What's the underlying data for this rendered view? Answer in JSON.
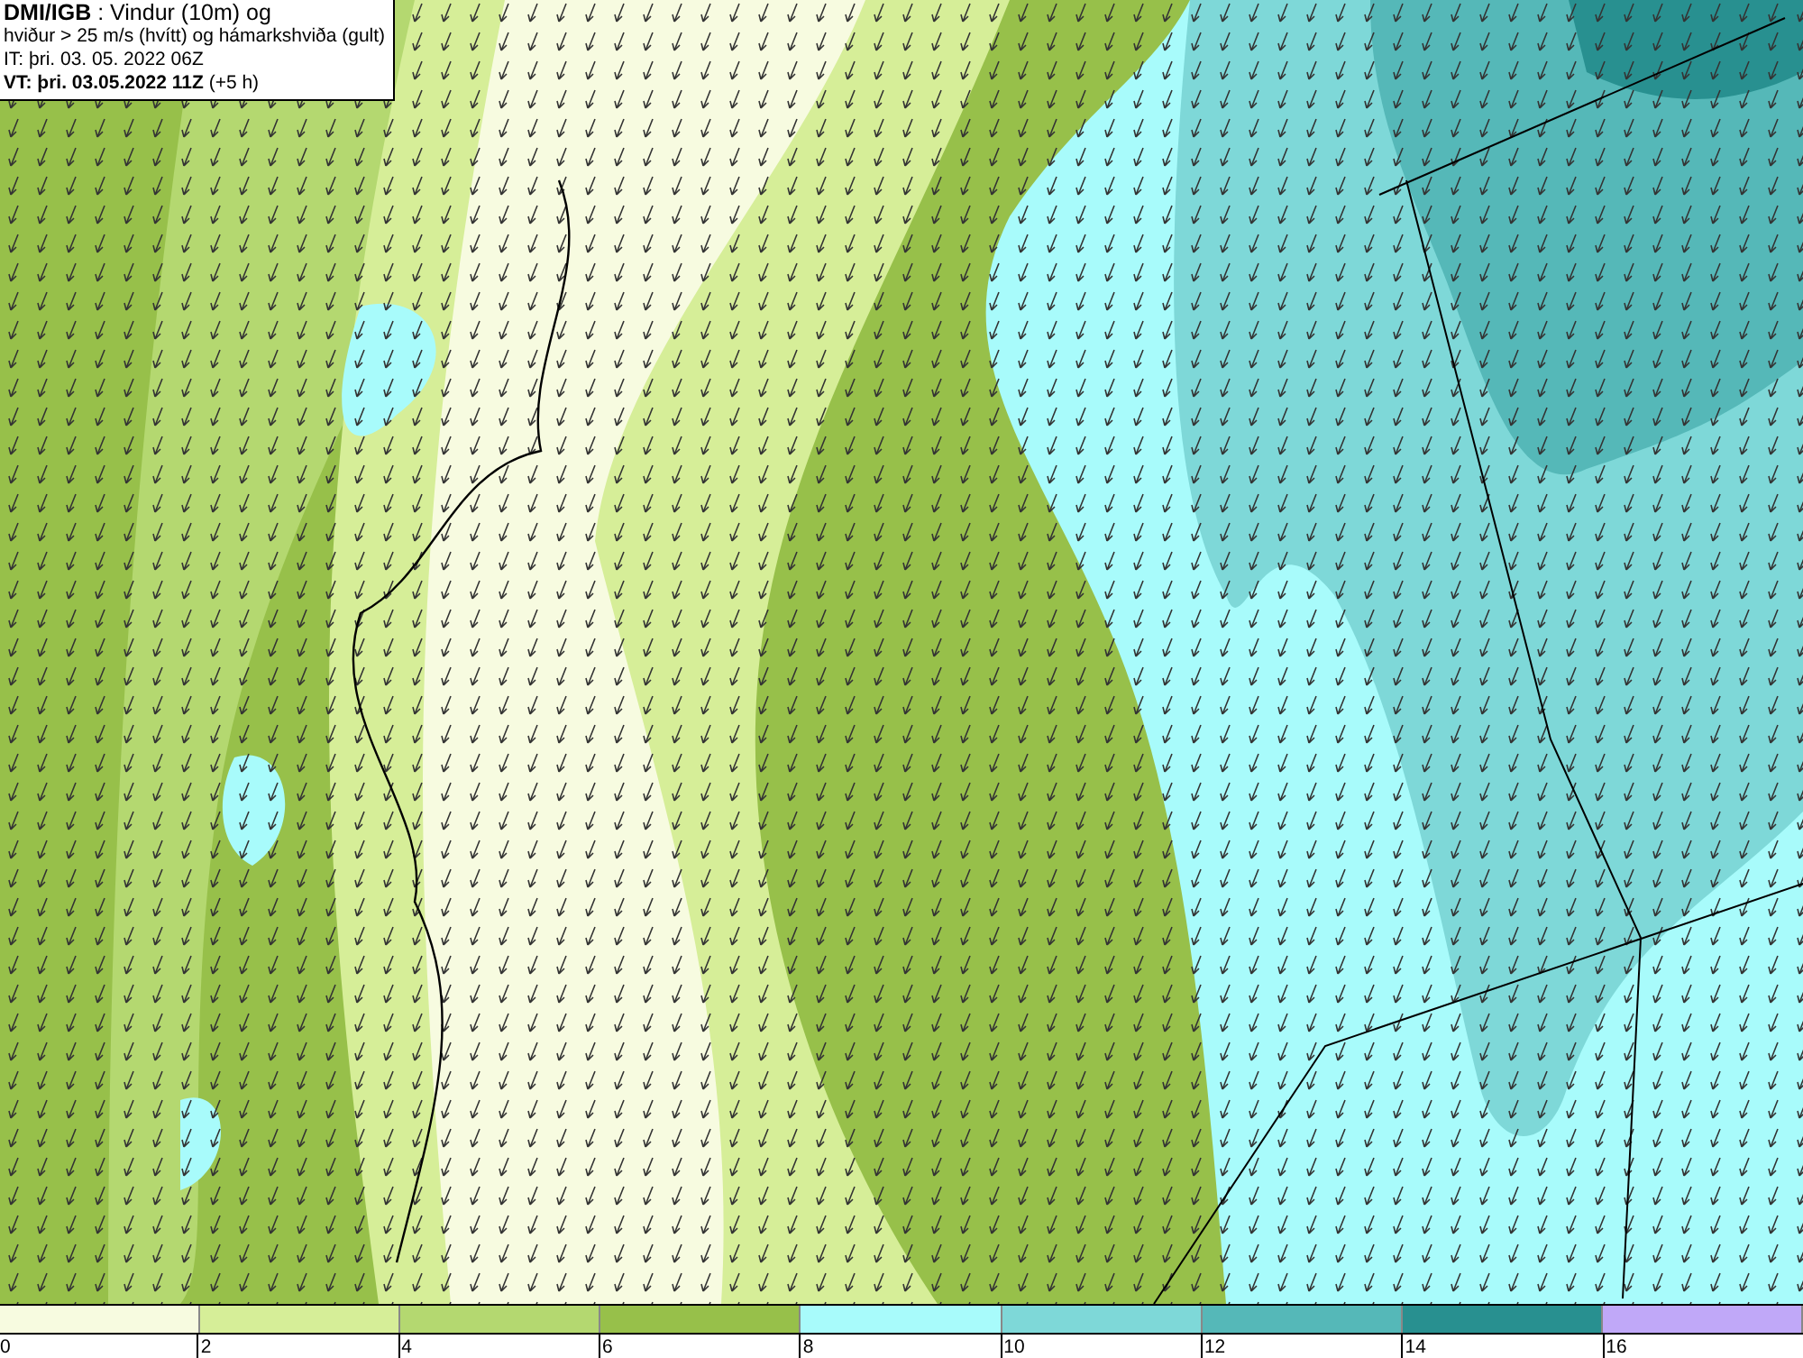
{
  "title_box": {
    "lines": [
      "**DMI/IGB** : Vindur (10m) og",
      "hviður > 25 m/s (hvítt) og hámarkshviða (gult)",
      "IT: þri. 03. 05. 2022 06Z",
      "**VT: þri. 03.05.2022 11Z** (+5 h)"
    ]
  },
  "legend": {
    "segments": [
      {
        "color": "#f7fbe0"
      },
      {
        "color": "#d6ee98"
      },
      {
        "color": "#b4d870"
      },
      {
        "color": "#97c04a"
      },
      {
        "color": "#a8fbfb"
      },
      {
        "color": "#7ed8d8"
      },
      {
        "color": "#55b8b8"
      },
      {
        "color": "#289090"
      },
      {
        "color": "#c0a8f8"
      }
    ],
    "ticks": [
      "0",
      "2",
      "4",
      "6",
      "8",
      "10",
      "12",
      "14",
      "16"
    ]
  }
}
